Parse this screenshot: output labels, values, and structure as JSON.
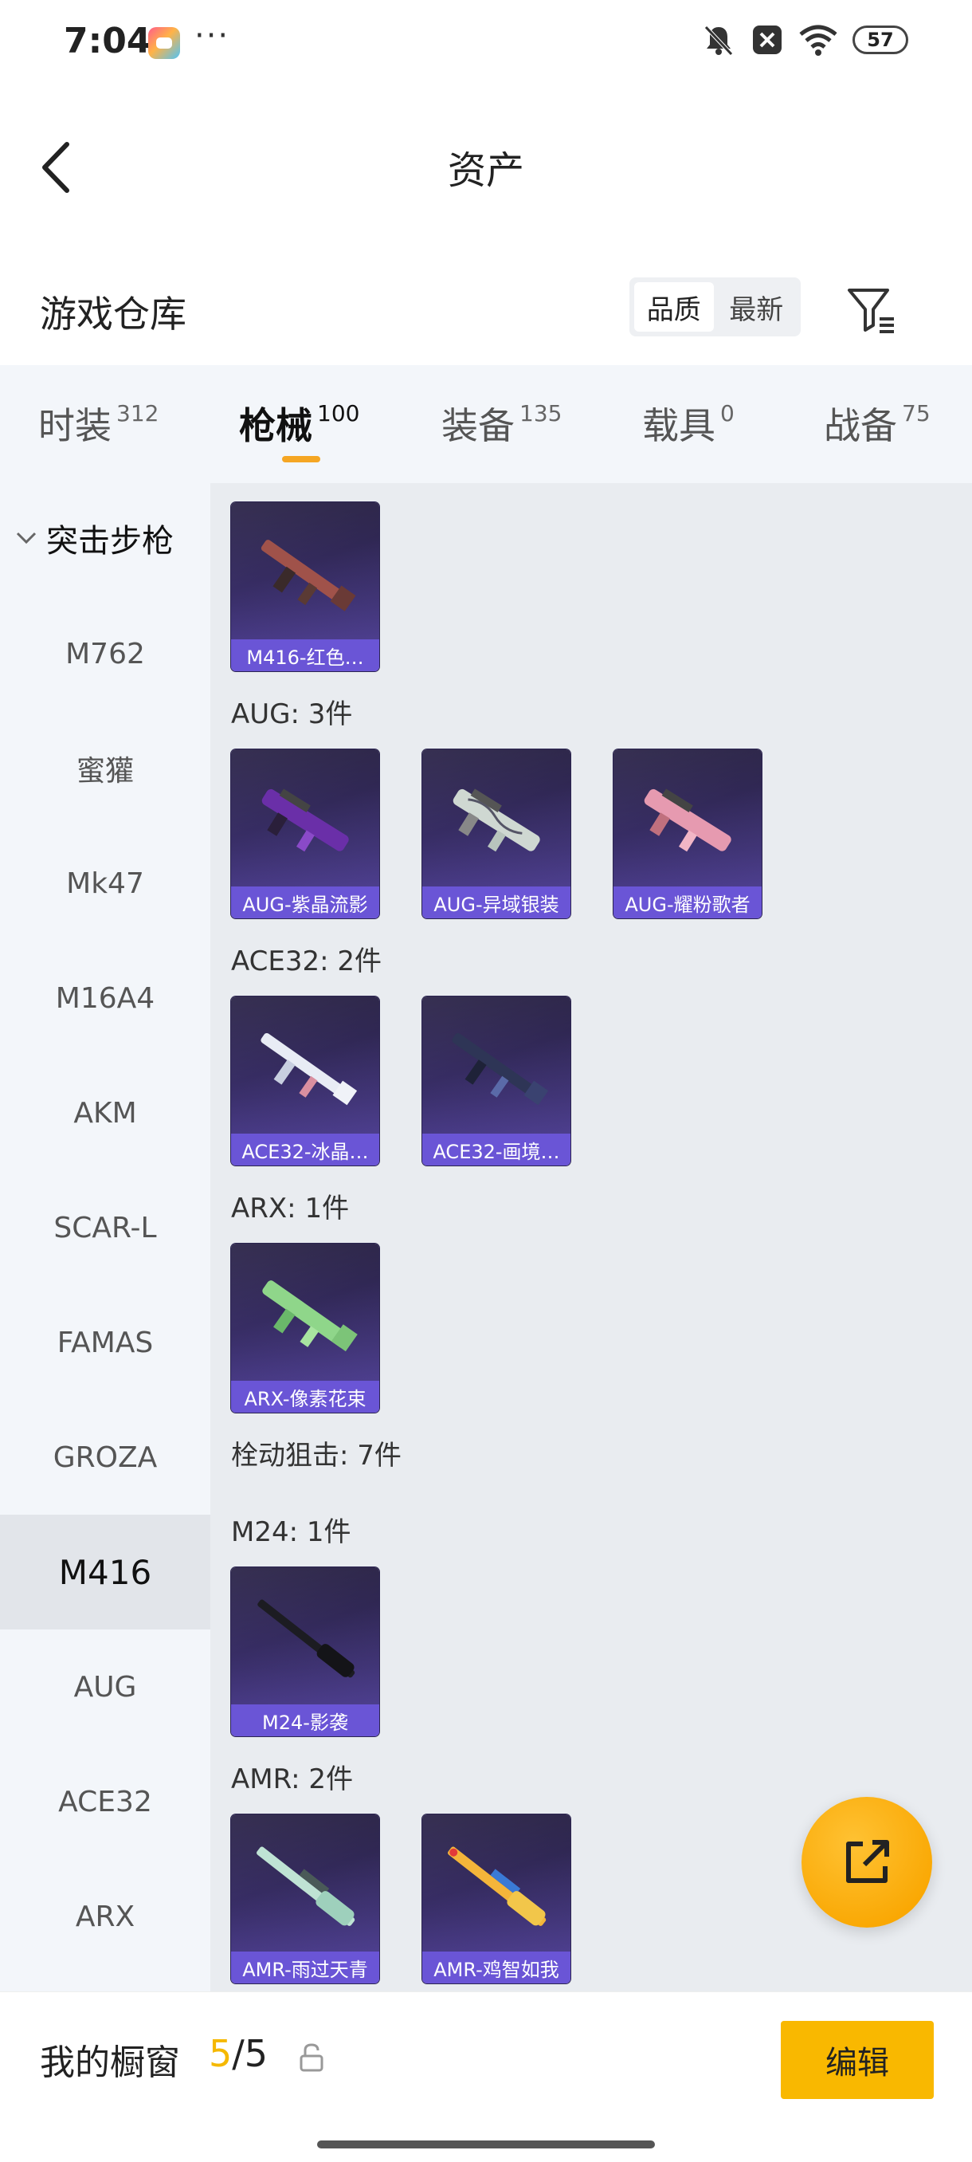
{
  "status_bar": {
    "time": "7:04",
    "dots": "···",
    "battery": "57"
  },
  "header": {
    "title": "资产"
  },
  "section": {
    "title": "游戏仓库",
    "sort_options": [
      "品质",
      "最新"
    ]
  },
  "tabs": [
    {
      "label": "时装",
      "count": "312"
    },
    {
      "label": "枪械",
      "count": "100"
    },
    {
      "label": "装备",
      "count": "135"
    },
    {
      "label": "载具",
      "count": "0"
    },
    {
      "label": "战备",
      "count": "75"
    }
  ],
  "sidebar": {
    "group_label": "突击步枪",
    "items": [
      "M762",
      "蜜獾",
      "Mk47",
      "M16A4",
      "AKM",
      "SCAR-L",
      "FAMAS",
      "GROZA",
      "M416",
      "AUG",
      "ACE32",
      "ARX"
    ],
    "selected": "M416"
  },
  "content": {
    "cards": {
      "m416_red": "M416-红色…",
      "aug_purple": "AUG-紫晶流影",
      "aug_silver": "AUG-异域银装",
      "aug_pink": "AUG-耀粉歌者",
      "ace32_ice": "ACE32-冰晶…",
      "ace32_paint": "ACE32-画境…",
      "arx_pixel": "ARX-像素花束",
      "m24_shadow": "M24-影袭",
      "amr_rain": "AMR-雨过天青",
      "amr_chicken": "AMR-鸡智如我"
    },
    "labels": {
      "aug": "AUG: 3件",
      "ace32": "ACE32: 2件",
      "arx": "ARX: 1件",
      "bolt": "栓动狙击: 7件",
      "m24": "M24: 1件",
      "amr": "AMR: 2件"
    }
  },
  "bottom_bar": {
    "label": "我的橱窗",
    "current": "5",
    "total": "/5",
    "edit_label": "编辑"
  },
  "colors": {
    "accent": "#f9b800",
    "card_label": "#6a55d6",
    "tab_underline": "#f5a623"
  }
}
